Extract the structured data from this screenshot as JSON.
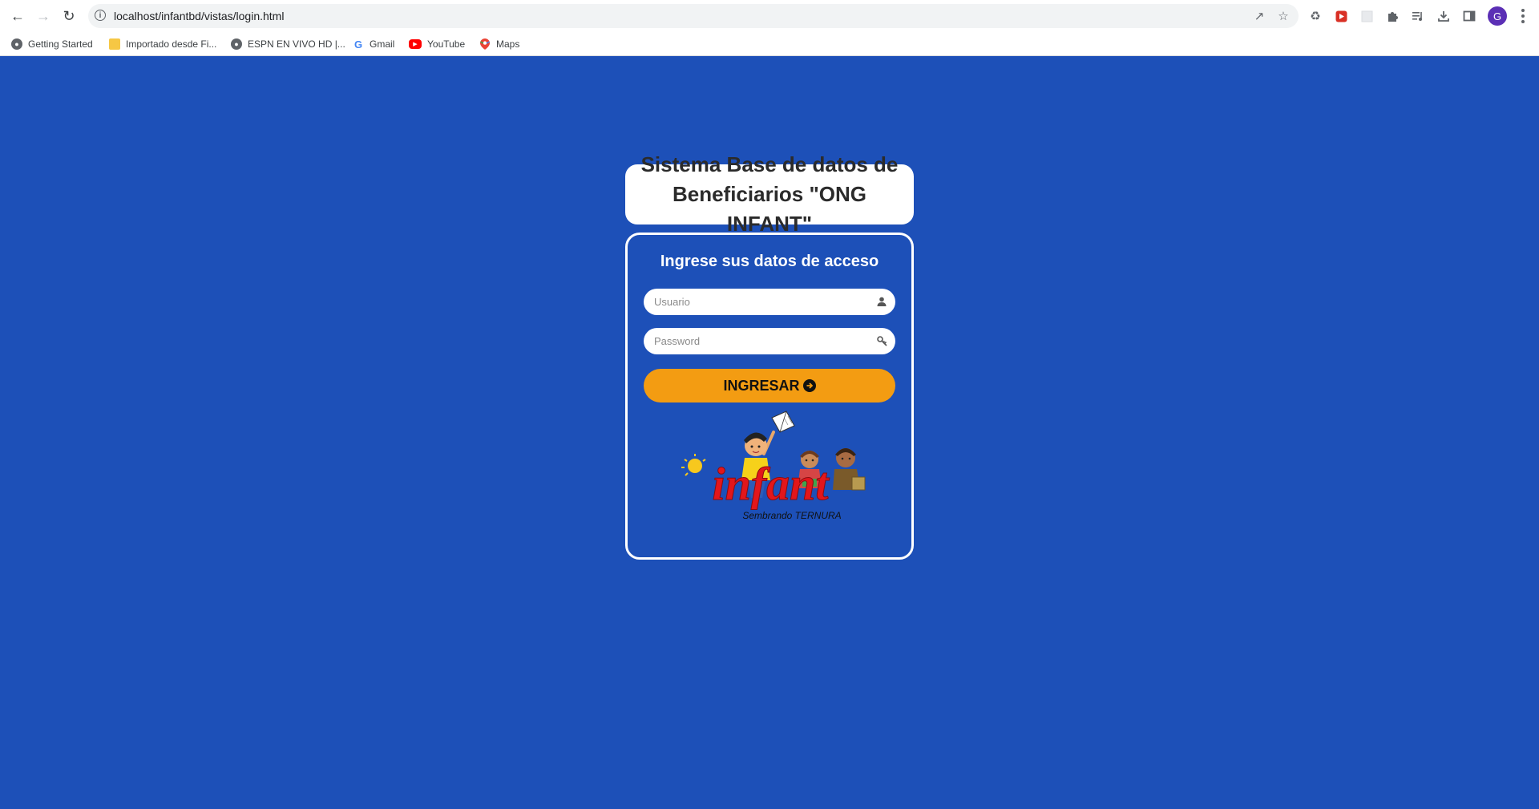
{
  "browser": {
    "url": "localhost/infantbd/vistas/login.html",
    "profile_initial": "G",
    "bookmarks": [
      {
        "label": "Getting Started",
        "icon": "globe-icon"
      },
      {
        "label": "Importado desde Fi...",
        "icon": "folder-icon"
      },
      {
        "label": "ESPN EN VIVO HD |...",
        "icon": "globe-icon"
      },
      {
        "label": "Gmail",
        "icon": "google-icon"
      },
      {
        "label": "YouTube",
        "icon": "youtube-icon"
      },
      {
        "label": "Maps",
        "icon": "maps-pin-icon"
      }
    ]
  },
  "page": {
    "background_color": "#1d50b8",
    "title": "Sistema Base de datos de Beneficiarios \"ONG INFANT\"",
    "login": {
      "heading": "Ingrese sus datos de acceso",
      "username_placeholder": "Usuario",
      "password_placeholder": "Password",
      "submit_label": "INGRESAR",
      "button_color": "#f39c12"
    },
    "logo": {
      "brand": "infant",
      "tagline": "Sembrando TERNURA"
    }
  }
}
